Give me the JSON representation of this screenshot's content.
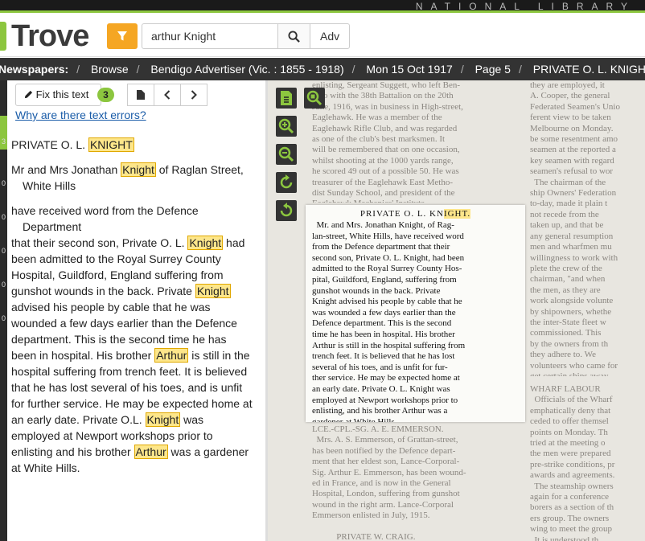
{
  "topbar": {
    "org": "NATIONAL LIBRARY"
  },
  "header": {
    "logo_text": "Trove",
    "search_value": "arthur Knight",
    "advanced_label": "Adv"
  },
  "breadcrumb": {
    "items": [
      "Newspapers:",
      "Browse",
      "Bendigo Advertiser (Vic. : 1855 - 1918)",
      "Mon 15 Oct 1917",
      "Page 5",
      "PRIVATE O. L. KNIGHT."
    ]
  },
  "sidebar_markers": [
    "3",
    "0",
    "0",
    "0",
    "0",
    "0"
  ],
  "text_panel": {
    "fix_label": "Fix this text",
    "corrections_count": "3",
    "why_link": "Why are there text errors?"
  },
  "article": {
    "headline_pre": "PRIVATE O. L. ",
    "headline_hl": "KNIGHT",
    "p1_pre": "Mr and Mrs Jonathan ",
    "p1_hl": "Knight",
    "p1_post": " of Raglan Street, White Hills",
    "p2": "have received word from the Defence Department",
    "p3_pre": "that their second son, Private O. L. ",
    "p3_hl": "Knight",
    "p3_mid": " had been admitted to the Royal Surrey County Hospital, Guildford, England suffering from gunshot wounds in the back. Private ",
    "p3_hl2": "Knight",
    "p3_mid2": " advised his people by cable that he was wounded a few days earlier than the Defence department. This is the second time he has been in hospital. His brother ",
    "p3_hl3": "Arthur",
    "p3_mid3": " is still in the hospital suffering from trench feet. It is believed that he has lost several of his toes, and is unfit for further service. He may be expected home at an early date. Private O.L. ",
    "p3_hl4": "Knight",
    "p3_mid4": " was employed at Newport workshops prior to enlisting and his brother ",
    "p3_hl5": "Arthur",
    "p3_end": " was a gardener at White Hills."
  },
  "scan": {
    "left_col": "enlisting, Sergeant Suggett, who left Ben-\ndigo with the 38th Battalion on the 20th\nJune, 1916, was in business in High-street,\nEaglehawk. He was a member of the\nEaglehawk Rifle Club, and was regarded\nas one of the club's best marksmen. It\nwill be remembered that on one occasion,\nwhilst shooting at the 1000 yards range,\nhe scored 49 out of a possible 50. He was\ntreasurer of the Eaglehawk East Metho-\ndist Sunday School, and president of the\nEaglehawk Mechanics' Institute.",
    "right_col": "they are employed, it\nA. Cooper, the general\nFederated Seamen's Unio\nferent view to be taken\nMelbourne on Monday.\nbe some resentment amo\nseamen at the reported a\nkey seamen with regard\nseamen's refusal to wor\n  The chairman of the\nship Owners' Federation\nto-day, made it plain t\nnot recede from the\ntaken up, and that be\nany general resumption\nmen and wharfmen mu\nwillingness to work with\nplete the crew of the\nchairman, \"and when\nthe men, as they are\nwork alongside volunte\nby shipowners, whethe\nthe inter-State fleet w\ncommissioned. This\nby the owners from th\nthey adhere to. We\nvolunteers who came for\nget certain ships away.\nment should crystallise",
    "right_col2": "WHARF LABOUR\n  Officials of the Wharf\nemphatically deny that\nceded to offer themsel\npoints on Monday. Th\ntried at the meeting o\nthe men were prepared\npre-strike conditions, pr\nawards and agreements.\n  The steamship owners\nagain for a conference\nborers as a section of th\ners group. The owners\nwing to meet the group\n  It is understood th\nWorkers' Federation is",
    "left_col2": "LCE.-CPL.-SG. A. E. EMMERSON.\n  Mrs. A. S. Emmerson, of Grattan-street,\nhas been notified by the Defence depart-\nment that her eldest son, Lance-Corporal-\nSig. Arthur E. Emmerson, has been wound-\ned in France, and is now in the General\nHospital, London, suffering from gunshot\nwound in the right arm. Lance-Corporal\nEmmerson enlisted in July, 1915.\n\n           PRIVATE W. CRAIG.\n  Mr. and Mrs. J. P. Craig, of Leal Point-street,",
    "clip_title_pre": "PRIVATE O. L. KN",
    "clip_title_hl": "IGHT.",
    "clip_body": "  Mr. and Mrs. Jonathan Knight, of Rag-\nlan-street, White Hills, have received word\nfrom the Defence department that their\nsecond son, Private O. L. Knight, had been\nadmitted to the Royal Surrey County Hos-\npital, Guildford, England, suffering from\ngunshot wounds in the back. Private\nKnight advised his people by cable that he\nwas wounded a few days earlier than the\nDefence department. This is the second\ntime he has been in hospital. His brother\nArthur is still in the hospital suffering from\ntrench feet. It is believed that he has lost\nseveral of his toes, and is unfit for fur-\nther service. He may be expected home at\nan early date. Private O. L. Knight was\nemployed at Newport workshops prior to\nenlisting, and his brother Arthur was a\ngardener at White Hills."
  },
  "colors": {
    "accent_green": "#8cc63f",
    "highlight": "#fde68a",
    "filter_orange": "#f5a623"
  }
}
